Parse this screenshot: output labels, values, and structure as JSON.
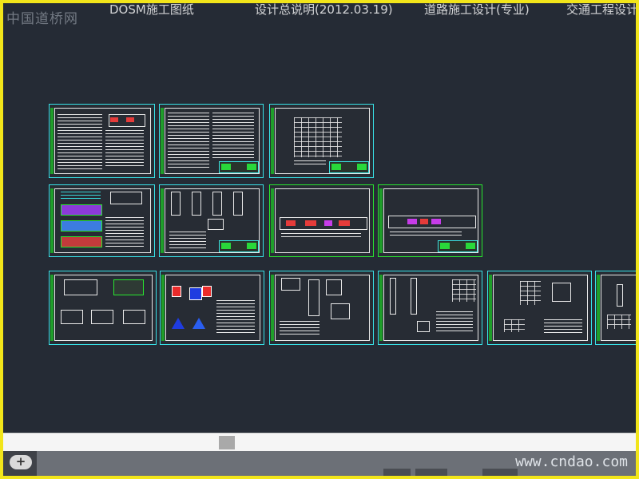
{
  "app": {
    "watermark_top": "中国道桥网",
    "watermark_bottom": "www.cndao.com",
    "top_texts": [
      "DOSM施工图纸",
      "设计总说明(2012.03.19)",
      "道路施工设计(专业)",
      "交通工程设计"
    ]
  },
  "drawing": {
    "background_color": "#252b35",
    "sheet_border_cyan": "#38e2e8",
    "sheet_border_green": "#28e62f"
  },
  "scrollbar": {
    "add_label": "+"
  }
}
